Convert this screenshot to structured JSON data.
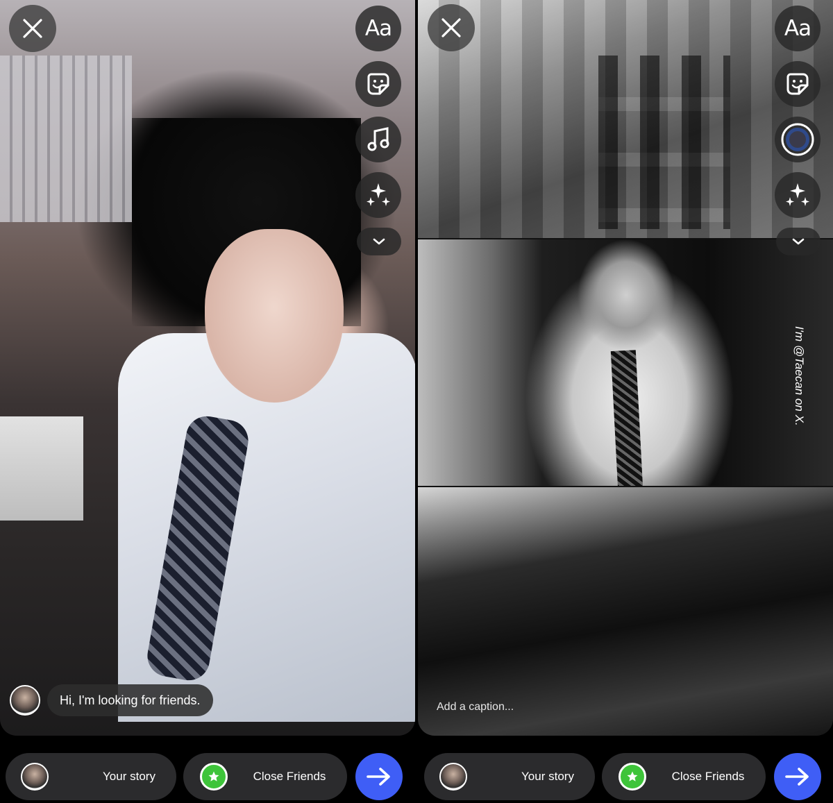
{
  "left": {
    "comment_text": "Hi, I'm looking for friends.",
    "tool_text_label": "Aa",
    "your_story_label": "Your story",
    "close_friends_label": "Close Friends"
  },
  "right": {
    "caption_placeholder": "Add a caption...",
    "watermark_text": "I'm @Taecan on X.",
    "tool_text_label": "Aa",
    "your_story_label": "Your story",
    "close_friends_label": "Close Friends"
  },
  "colors": {
    "send_button": "#3f5ef6",
    "close_friends_green": "#3ec43a",
    "pill_background": "#2b2b2d"
  },
  "icons": {
    "close": "close-icon",
    "text": "text-tool-icon",
    "sticker": "sticker-icon",
    "music": "music-note-icon",
    "effects": "sparkles-icon",
    "more": "chevron-down-icon",
    "send": "arrow-right-icon",
    "star": "star-icon"
  }
}
